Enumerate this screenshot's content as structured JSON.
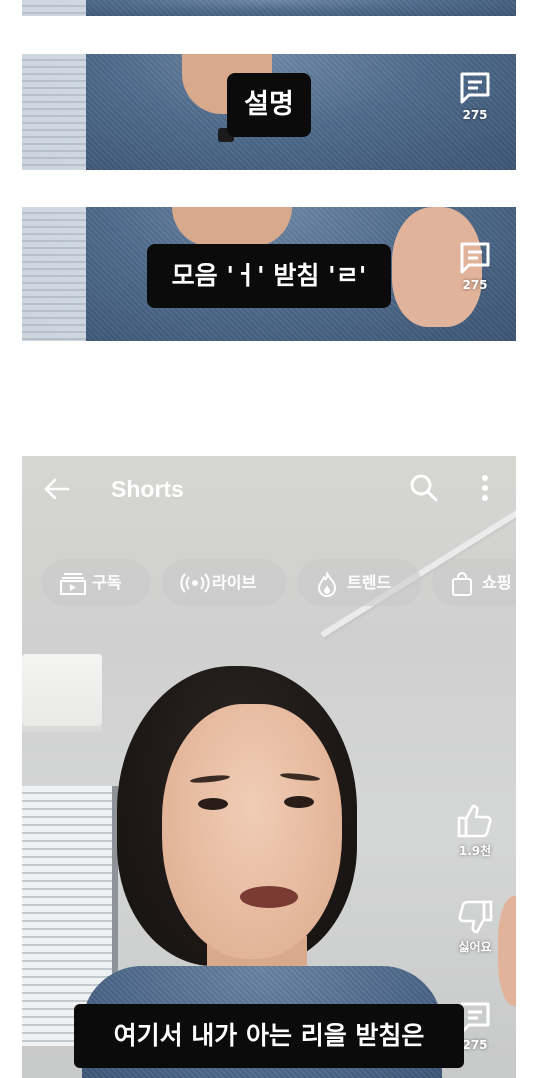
{
  "frames": [
    {
      "id": "top",
      "caption": null
    },
    {
      "id": "a",
      "caption": "설명",
      "comment_count": "275"
    },
    {
      "id": "b",
      "caption": "모음 'ㅓ' 받침 'ㄹ'",
      "comment_count": "275"
    }
  ],
  "shorts": {
    "header": {
      "title": "Shorts"
    },
    "chips": [
      {
        "label": "구독",
        "icon": "subscriptions-icon"
      },
      {
        "label": "라이브",
        "icon": "live-icon"
      },
      {
        "label": "트렌드",
        "icon": "trending-icon"
      },
      {
        "label": "쇼핑",
        "icon": "shopping-bag-icon"
      }
    ],
    "actions": {
      "like_count": "1.9천",
      "dislike_label": "싫어요",
      "comment_count": "275"
    },
    "caption": "여기서 내가 아는 리을 받침은"
  },
  "colors": {
    "caption_bg": "#0b0b0b",
    "caption_text": "#ffffff",
    "chip_bg": "rgba(200,200,200,0.55)",
    "icon_color": "#ffffff"
  }
}
